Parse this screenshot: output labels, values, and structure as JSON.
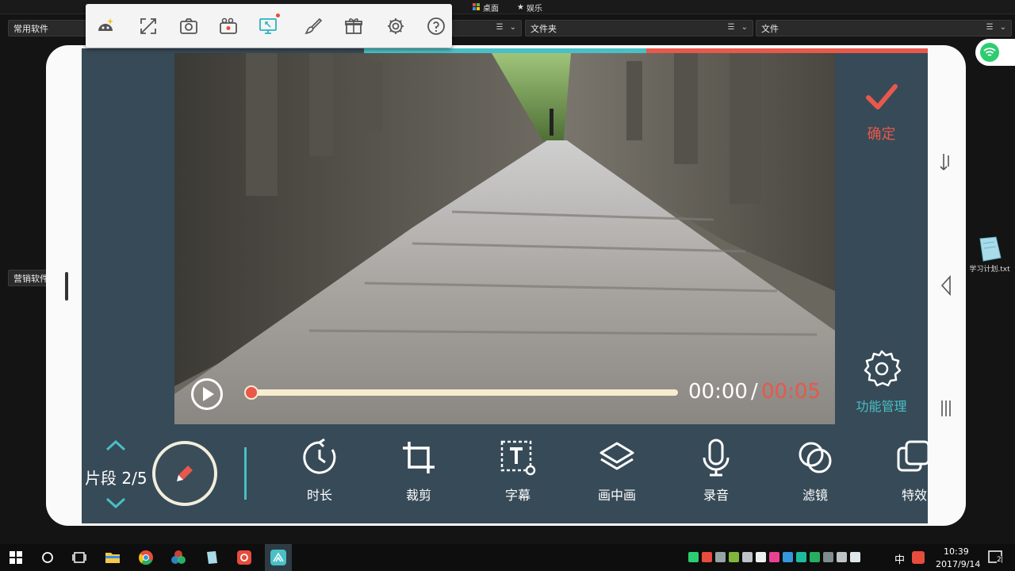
{
  "desktop": {
    "tabs": [
      {
        "label": "桌面"
      },
      {
        "label": "娱乐"
      }
    ],
    "fences": [
      {
        "label": "常用软件"
      },
      {
        "label": "文件夹"
      },
      {
        "label": "文件"
      },
      {
        "label": "营销软件"
      }
    ],
    "file_icon_label": "学习计划.txt"
  },
  "app": {
    "confirm_label": "确定",
    "function_label": "功能管理",
    "time_current": "00:00",
    "time_separator": "/",
    "time_total": "00:05",
    "segment_label": "片段 2/5",
    "tools": [
      {
        "label": "时长",
        "icon": "clock-icon"
      },
      {
        "label": "裁剪",
        "icon": "crop-icon"
      },
      {
        "label": "字幕",
        "icon": "subtitle-icon"
      },
      {
        "label": "画中画",
        "icon": "layers-icon"
      },
      {
        "label": "录音",
        "icon": "microphone-icon"
      },
      {
        "label": "滤镜",
        "icon": "filter-icon"
      },
      {
        "label": "特效",
        "icon": "effects-icon"
      }
    ],
    "accent_teal": "#48c0c6",
    "accent_red": "#e8584b",
    "panel_color": "#374a57"
  },
  "taskbar": {
    "time": "10:39",
    "date": "2017/9/14",
    "ime": "中",
    "notification_count": "2"
  }
}
